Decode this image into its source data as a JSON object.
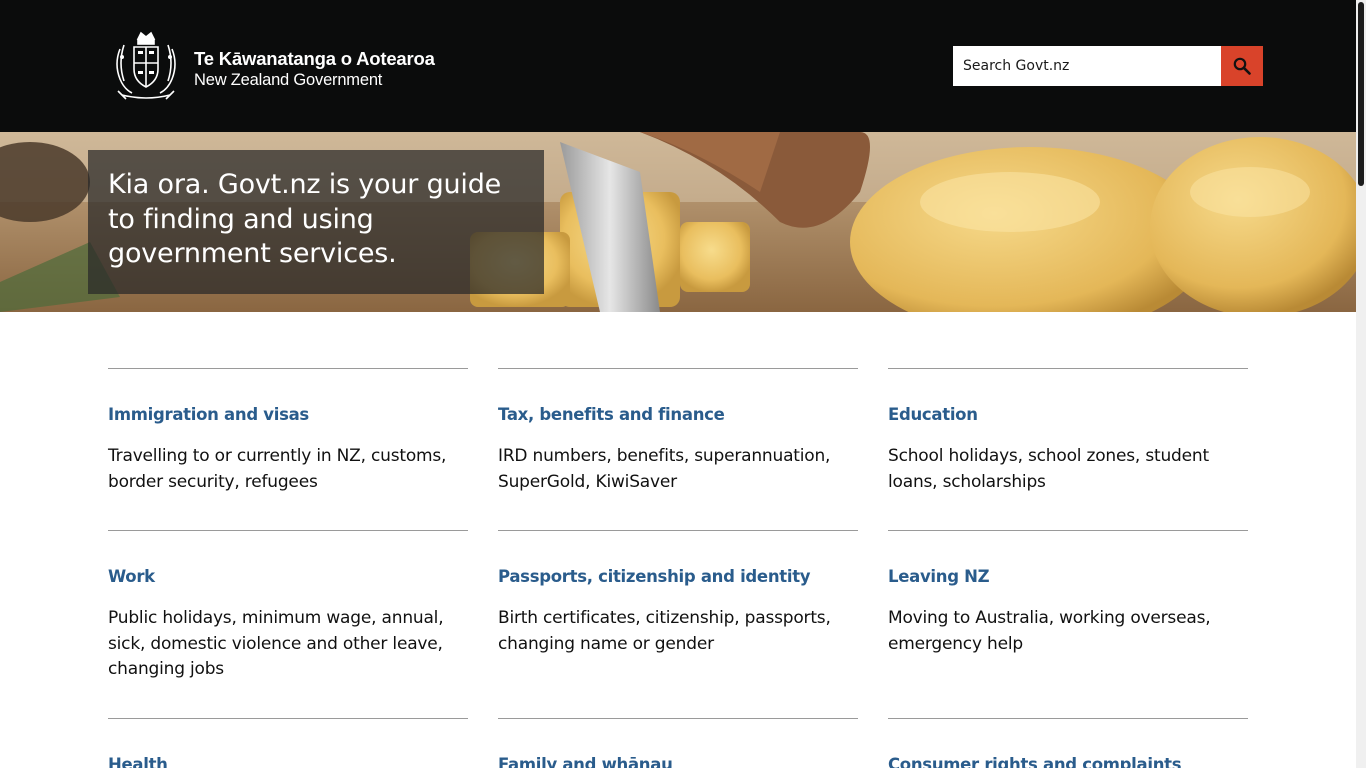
{
  "header": {
    "logo_maori": "Te Kāwanatanga o Aotearoa",
    "logo_english": "New Zealand Government",
    "background": "#0b0c0c"
  },
  "search": {
    "placeholder": "Search Govt.nz",
    "button_icon": "search-icon",
    "button_color": "#d9432a"
  },
  "hero": {
    "text": "Kia ora. Govt.nz is your guide to finding and using government services."
  },
  "topics": [
    {
      "title": "Immigration and visas",
      "description": "Travelling to or currently in NZ, customs, border security, refugees"
    },
    {
      "title": "Tax, benefits and finance",
      "description": "IRD numbers, benefits, superannuation, SuperGold, KiwiSaver"
    },
    {
      "title": "Education",
      "description": "School holidays, school zones, student loans, scholarships"
    },
    {
      "title": "Work",
      "description": "Public holidays, minimum wage, annual, sick, domestic violence and other leave, changing jobs"
    },
    {
      "title": "Passports, citizenship and identity",
      "description": "Birth certificates, citizenship, passports, changing name or gender"
    },
    {
      "title": "Leaving NZ",
      "description": "Moving to Australia, working overseas, emergency help"
    },
    {
      "title": "Health",
      "description": ""
    },
    {
      "title": "Family and whānau",
      "description": ""
    },
    {
      "title": "Consumer rights and complaints",
      "description": ""
    }
  ],
  "colors": {
    "link": "#2a5c8c",
    "accent": "#d9432a"
  }
}
